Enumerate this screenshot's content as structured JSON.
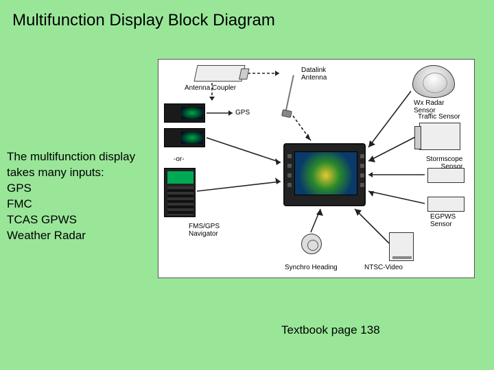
{
  "title": "Multifunction Display Block Diagram",
  "description": {
    "intro": "The multifunction display takes many inputs:",
    "inputs": [
      "GPS",
      "FMC",
      "TCAS GPWS",
      "Weather Radar"
    ]
  },
  "footer": "Textbook page 138",
  "diagram": {
    "labels": {
      "antenna_coupler": "Antenna Coupler",
      "gps": "GPS",
      "or": "-or-",
      "fms_gps_navigator": "FMS/GPS\nNavigator",
      "datalink_antenna": "Datalink\nAntenna",
      "wx_radar_sensor": "Wx Radar\nSensor",
      "traffic_sensor": "Traffic Sensor",
      "stormscope_sensor": "Stormscope\nSensor",
      "egpws_sensor": "EGPWS\nSensor",
      "synchro_heading": "Synchro Heading",
      "ntsc_video": "NTSC-Video"
    }
  }
}
